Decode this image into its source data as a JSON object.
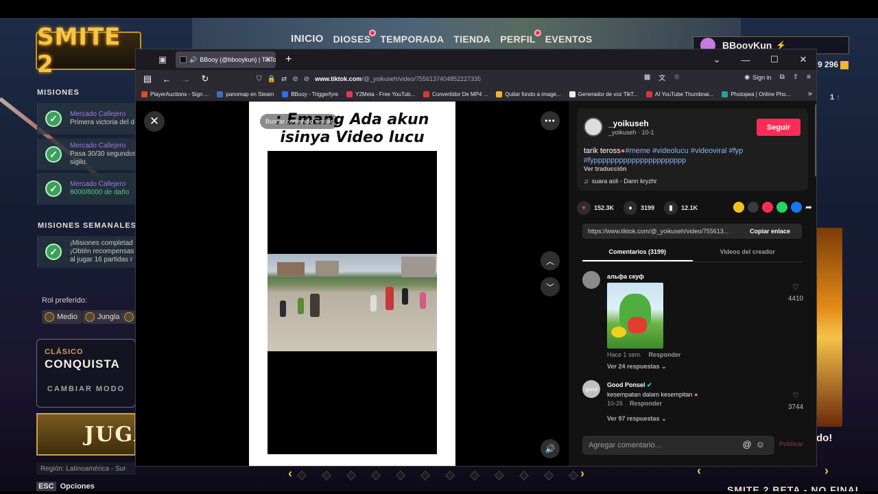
{
  "game": {
    "logo": "SMITE 2",
    "nav": [
      {
        "label": "INICIO",
        "dot": false
      },
      {
        "label": "DIOSES",
        "dot": true
      },
      {
        "label": "TEMPORADA",
        "dot": false
      },
      {
        "label": "TIENDA",
        "dot": false
      },
      {
        "label": "PERFIL",
        "dot": true
      },
      {
        "label": "EVENTOS",
        "dot": false
      }
    ],
    "player_name": "BBooyKun",
    "currency": "9 296",
    "count_label": "1",
    "missions_title": "MISIONES",
    "missions": [
      {
        "title": "Mercado Callejero",
        "line1": "Primera victoria del d",
        "line2": ""
      },
      {
        "title": "Mercado Callejero",
        "line1": "Pasa 30/30 segundos",
        "line2": "sigilo."
      },
      {
        "title": "Mercado Callejero",
        "line1": "8000/8000 de daño",
        "line2": ""
      }
    ],
    "weekly_title": "MISIONES SEMANALES",
    "weekly": {
      "line1": "¡Misiones completad",
      "line2": "¡Obtén recompensas",
      "line3": "al jugar 16 partidas r"
    },
    "role_label": "Rol preferido:",
    "roles": [
      "Medio",
      "Jungla"
    ],
    "mode": {
      "type": "CLÁSICO",
      "name": "CONQUISTA",
      "change": "CAMBIAR MODO"
    },
    "play_label": "JUGA",
    "region": "Región: Latinoamérica - Sur",
    "esc_key": "ESC",
    "esc_label": "Opciones",
    "right_text": "do!",
    "beta": "SMITE 2 BETA - NO FINAL"
  },
  "browser": {
    "tab_title": "BBooy (@bbooykun) | TikTo",
    "url_host": "www.tiktok.com",
    "url_path": "/@_yoikuseh/video/7556137404852227335",
    "signin": "Sign in",
    "bookmarks": [
      {
        "label": "PlayerAuctions - Sign ...",
        "color": "#d94b2b"
      },
      {
        "label": "panomap en Steam",
        "color": "#3c6fb8"
      },
      {
        "label": "BBooy - Triggerfyre",
        "color": "#2f6fe0"
      },
      {
        "label": "Y2Meta - Free YouTub...",
        "color": "#e03a4e"
      },
      {
        "label": "Convertidor De MP4 ...",
        "color": "#d33c2c"
      },
      {
        "label": "Quitar fondo a image...",
        "color": "#f2b233"
      },
      {
        "label": "Generador de voz TikT...",
        "color": "#eeeeee"
      },
      {
        "label": "AI YouTube Thumbnai...",
        "color": "#d33a3a"
      },
      {
        "label": "Photopea | Online Pho...",
        "color": "#1fa2a0"
      }
    ]
  },
  "tiktok": {
    "caption_line1": ": Emang Ada akun",
    "caption_line2": "isinya Video lucu",
    "search_hint": "Buscar contenido similar",
    "author": "_yoikuseh",
    "author_sub": "_yoikuseh · 10-1",
    "follow": "Seguir",
    "desc_prefix": "tarik teross",
    "tags1": "#meme #videolucu #videoviral #fyp",
    "tags2": "#fypppppppppppppppppppppp",
    "translate": "Ver traducción",
    "music": "suara asli - Dann kryzhr",
    "likes": "152.3K",
    "comments": "3199",
    "saves": "12.1K",
    "share_colors": [
      "#f2c21a",
      "#3a3a3a",
      "#fe2c55",
      "#25d366",
      "#1877f2"
    ],
    "link": "https://www.tiktok.com/@_yoikuseh/video/755613...",
    "copy": "Copiar enlace",
    "tab_comments": "Comentarios (3199)",
    "tab_creator": "Videos del creador",
    "comment1": {
      "user": "альфа скуф",
      "time": "Hace 1 sem.",
      "reply": "Responder",
      "replies": "Ver 24 respuestas",
      "likes": "4410"
    },
    "comment2": {
      "user": "Good Ponsel",
      "text": "kesempatan dalam kesempitan",
      "time": "10-26",
      "reply": "Responder",
      "replies": "Ver 97 respuestas",
      "likes": "3744",
      "avatar_text": "good"
    },
    "input_placeholder": "Agregar comentario...",
    "publish": "Publicar"
  }
}
